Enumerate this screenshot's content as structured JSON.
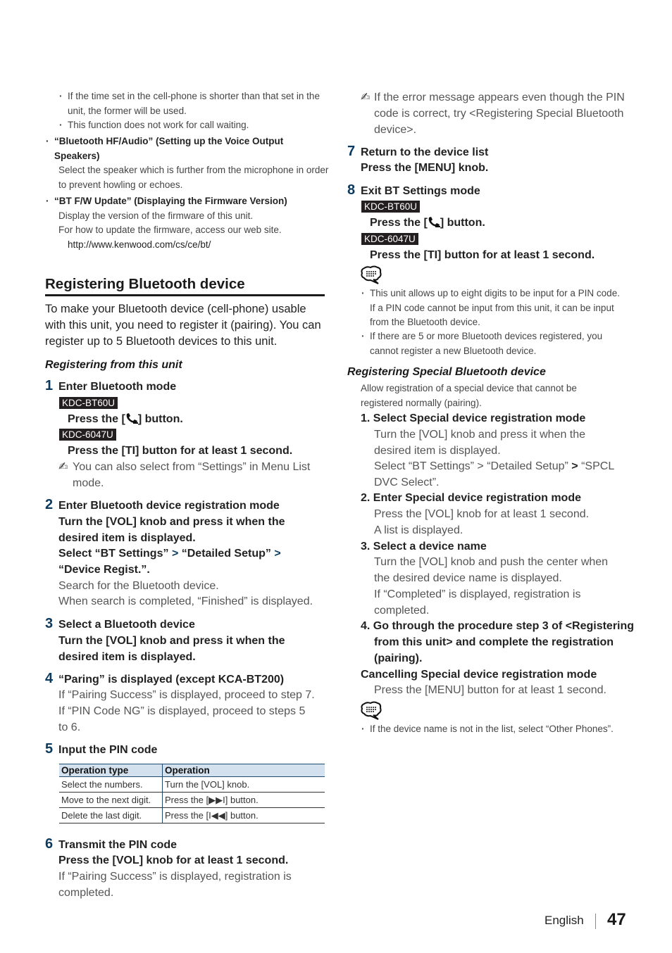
{
  "left": {
    "top_bullets": [
      "If the time set in the cell-phone is shorter than that set in the unit, the former will be used.",
      "This function does not work for call waiting."
    ],
    "items": [
      {
        "title": "“Bluetooth HF/Audio” (Setting up the Voice Output Speakers)",
        "desc": "Select the speaker which is further from the microphone in order to prevent howling or echoes."
      },
      {
        "title": "“BT F/W Update” (Displaying the Firmware Version)",
        "desc1": "Display the version of the firmware of this unit.",
        "desc2": "For how to update the firmware, access our web site.",
        "url": "http://www.kenwood.com/cs/ce/bt/"
      }
    ],
    "section_title": "Registering Bluetooth device",
    "intro": "To make your Bluetooth device (cell-phone) usable with this unit, you need to register it (pairing). You can register up to 5 Bluetooth devices to this unit.",
    "sub_title": "Registering from this unit",
    "steps": [
      {
        "num": "1",
        "title": "Enter Bluetooth mode",
        "model1": "KDC-BT60U",
        "action1_pre": "Press the [",
        "action1_post": "] button.",
        "model2": "KDC-6047U",
        "action2": "Press the [TI] button for at least 1 second.",
        "note": "You can also select from “Settings” in Menu List mode."
      },
      {
        "num": "2",
        "title": "Enter Bluetooth device registration mode",
        "line1": "Turn the [VOL] knob and press it when the desired item is displayed.",
        "sel_a": "Select “BT Settings”",
        "sel_b": "“Detailed Setup”",
        "sel_c": "“Device Regist.”.",
        "desc1": "Search for the Bluetooth device.",
        "desc2": "When search is completed, “Finished” is displayed."
      },
      {
        "num": "3",
        "title": "Select a Bluetooth device",
        "line1": "Turn the [VOL] knob and press it when the desired item is displayed."
      },
      {
        "num": "4",
        "title": "“Paring” is displayed (except KCA-BT200)",
        "desc1": "If “Pairing Success” is displayed, proceed to step 7.",
        "desc2": "If “PIN Code NG” is displayed, proceed to steps 5 to 6."
      },
      {
        "num": "5",
        "title": "Input the PIN code"
      },
      {
        "num": "6",
        "title": "Transmit the PIN code",
        "line1": "Press the [VOL] knob for at least 1 second.",
        "desc1": "If “Pairing Success” is displayed, registration is completed."
      }
    ],
    "table": {
      "headers": [
        "Operation type",
        "Operation"
      ],
      "rows": [
        [
          "Select the numbers.",
          "Turn the [VOL] knob."
        ],
        [
          "Move to the next digit.",
          "Press the [▶▶I] button."
        ],
        [
          "Delete the last digit.",
          "Press the [I◀◀] button."
        ]
      ]
    }
  },
  "right": {
    "top_note": "If the error message appears even though the PIN code is correct, try <Registering Special Bluetooth device>.",
    "steps": [
      {
        "num": "7",
        "title": "Return to the device list",
        "line1": "Press the [MENU] knob."
      },
      {
        "num": "8",
        "title": "Exit BT Settings mode",
        "model1": "KDC-BT60U",
        "action1_pre": "Press the [",
        "action1_post": "] button.",
        "model2": "KDC-6047U",
        "action2": "Press the [TI] button for at least 1 second."
      }
    ],
    "notes": [
      "This unit allows up to eight digits to be input for a PIN code. If a PIN code cannot be input from this unit, it can be input from the Bluetooth device.",
      "If there are 5 or more Bluetooth devices registered, you cannot register a new Bluetooth device."
    ],
    "special": {
      "title": "Registering Special Bluetooth device",
      "intro": "Allow registration of a special device that cannot be registered normally (pairing).",
      "steps": [
        {
          "title": "1. Select Special device registration mode",
          "l1": "Turn the [VOL] knob and press it when the desired item is displayed.",
          "l2a": "Select “BT Settings” > “Detailed Setup”",
          "l2b": "“SPCL DVC Select”."
        },
        {
          "title": "2. Enter Special device registration mode",
          "l1": "Press the [VOL] knob for at least 1 second.",
          "l2": "A list is displayed."
        },
        {
          "title": "3. Select a device name",
          "l1": "Turn the [VOL] knob and push the center when the desired device name is displayed.",
          "l2": "If “Completed” is displayed, registration is completed."
        },
        {
          "title": "4. Go through the procedure step 3 of <Registering from this unit> and complete the registration (pairing)."
        }
      ],
      "cancel_title": "Cancelling Special device registration mode",
      "cancel_line": "Press the [MENU] button for at least 1 second.",
      "final_note": "If the device name is not in the list, select “Other Phones”."
    }
  },
  "footer": {
    "language": "English",
    "page": "47"
  },
  "colors": {
    "step_number": "#0b3a5e",
    "table_header": "#d3e1ee",
    "model_badge": "#231f20"
  }
}
